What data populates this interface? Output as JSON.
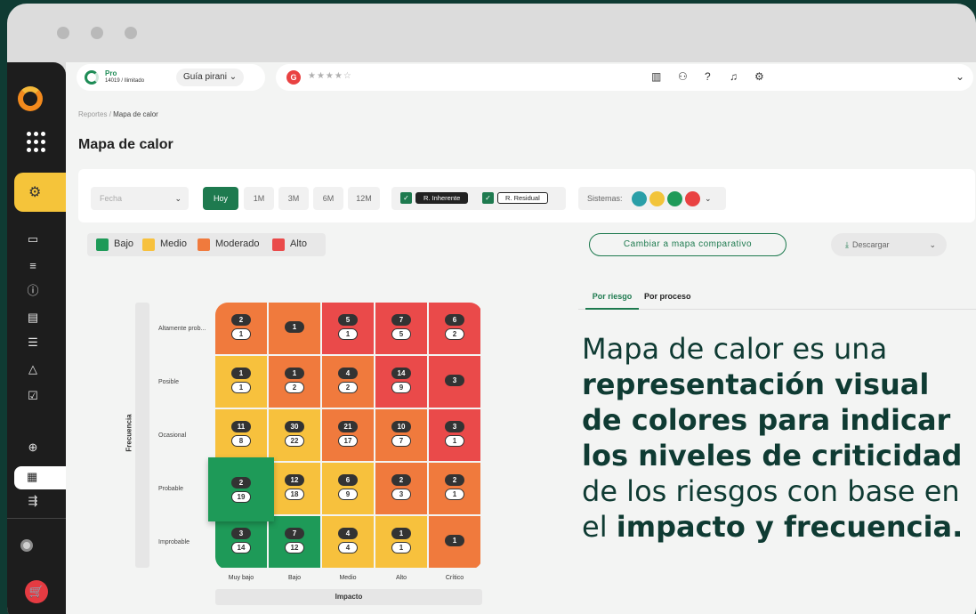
{
  "topbar": {
    "plan": "Pro",
    "usage": "14019 / Ilimitado",
    "guide": "Guía pirani",
    "star_rating": "★★★★☆"
  },
  "breadcrumb": {
    "parent": "Reportes",
    "current": "Mapa de calor"
  },
  "page_title": "Mapa de calor",
  "filters": {
    "date_placeholder": "Fecha",
    "periods": [
      "Hoy",
      "1M",
      "3M",
      "6M",
      "12M"
    ],
    "selected_period": "Hoy",
    "risk_types": [
      "R. Inherente",
      "R. Residual"
    ],
    "systems_label": "Sistemas:"
  },
  "legend": [
    {
      "label": "Bajo",
      "color": "#1e9a58"
    },
    {
      "label": "Medio",
      "color": "#f7c13d"
    },
    {
      "label": "Moderado",
      "color": "#f07a3d"
    },
    {
      "label": "Alto",
      "color": "#ea4a4a"
    }
  ],
  "actions": {
    "compare": "Cambiar a mapa comparativo",
    "download": "Descargar"
  },
  "heatmap": {
    "y_axis_label": "Frecuencia",
    "x_axis_label": "Impacto",
    "rows": [
      "Altamente prob...",
      "Posible",
      "Ocasional",
      "Probable",
      "Improbable"
    ],
    "cols": [
      "Muy bajo",
      "Bajo",
      "Medio",
      "Alto",
      "Crítico"
    ],
    "cells": [
      [
        {
          "c": "#f07a3d",
          "a": "2",
          "b": "1"
        },
        {
          "c": "#f07a3d",
          "a": "1",
          "b": null
        },
        {
          "c": "#ea4a4a",
          "a": "5",
          "b": "1"
        },
        {
          "c": "#ea4a4a",
          "a": "7",
          "b": "5"
        },
        {
          "c": "#ea4a4a",
          "a": "6",
          "b": "2"
        }
      ],
      [
        {
          "c": "#f7c13d",
          "a": "1",
          "b": "1"
        },
        {
          "c": "#f07a3d",
          "a": "1",
          "b": "2"
        },
        {
          "c": "#f07a3d",
          "a": "4",
          "b": "2"
        },
        {
          "c": "#ea4a4a",
          "a": "14",
          "b": "9"
        },
        {
          "c": "#ea4a4a",
          "a": "3",
          "b": null
        }
      ],
      [
        {
          "c": "#f7c13d",
          "a": "11",
          "b": "8"
        },
        {
          "c": "#f7c13d",
          "a": "30",
          "b": "22"
        },
        {
          "c": "#f07a3d",
          "a": "21",
          "b": "17"
        },
        {
          "c": "#f07a3d",
          "a": "10",
          "b": "7"
        },
        {
          "c": "#ea4a4a",
          "a": "3",
          "b": "1"
        }
      ],
      [
        {
          "c": "#1e9a58",
          "a": "2",
          "b": "19"
        },
        {
          "c": "#f7c13d",
          "a": "12",
          "b": "18"
        },
        {
          "c": "#f7c13d",
          "a": "6",
          "b": "9"
        },
        {
          "c": "#f07a3d",
          "a": "2",
          "b": "3"
        },
        {
          "c": "#f07a3d",
          "a": "2",
          "b": "1"
        }
      ],
      [
        {
          "c": "#1e9a58",
          "a": "3",
          "b": "14"
        },
        {
          "c": "#1e9a58",
          "a": "7",
          "b": "12"
        },
        {
          "c": "#f7c13d",
          "a": "4",
          "b": "4"
        },
        {
          "c": "#f7c13d",
          "a": "1",
          "b": "1"
        },
        {
          "c": "#f07a3d",
          "a": "1",
          "b": null
        }
      ]
    ]
  },
  "tabs": [
    "Por riesgo",
    "Por proceso"
  ],
  "description": {
    "p1": "Mapa de calor es una ",
    "b1": "representación visual de colores para indicar los niveles de criticidad",
    "p2": " de los riesgos con base en el ",
    "b2": "impacto y frecuencia."
  }
}
